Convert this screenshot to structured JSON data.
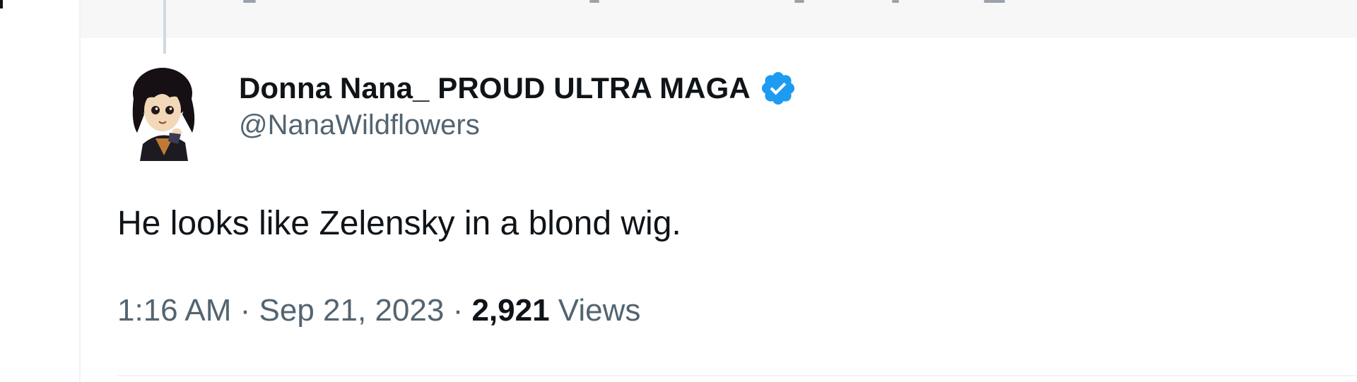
{
  "tweet": {
    "author": {
      "display_name": "Donna Nana_ PROUD ULTRA MAGA",
      "handle": "@NanaWildflowers",
      "verified": true,
      "verified_icon": "verified-badge-icon",
      "avatar_icon": "avatar-illustration"
    },
    "text": "He looks like Zelensky in a blond wig.",
    "meta": {
      "time": "1:16 AM",
      "separator": " · ",
      "date": "Sep 21, 2023",
      "views_count": "2,921",
      "views_label": "Views"
    }
  },
  "colors": {
    "text_primary": "#0f1419",
    "text_secondary": "#536471",
    "verified_blue": "#1d9bf0",
    "thread_line": "#cfd9de",
    "top_strip_bg": "#f7f7f7"
  }
}
